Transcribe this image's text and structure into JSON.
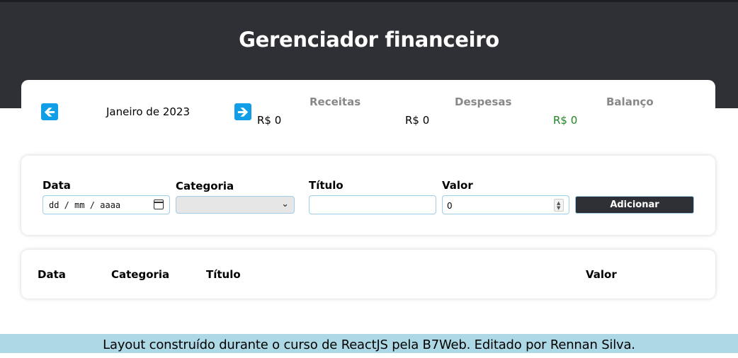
{
  "header": {
    "title": "Gerenciador financeiro"
  },
  "period": {
    "prev_icon": "arrow-left-icon",
    "label": "Janeiro de 2023",
    "next_icon": "arrow-right-icon"
  },
  "summary": {
    "receitas": {
      "title": "Receitas",
      "value": "R$ 0"
    },
    "despesas": {
      "title": "Despesas",
      "value": "R$ 0"
    },
    "balanco": {
      "title": "Balanço",
      "value": "R$ 0",
      "color": "#208520"
    }
  },
  "form": {
    "data": {
      "label": "Data",
      "placeholder": "dd / mm / aaaa"
    },
    "categoria": {
      "label": "Categoria",
      "value": ""
    },
    "titulo": {
      "label": "Título",
      "value": ""
    },
    "valor": {
      "label": "Valor",
      "value": "0"
    },
    "submit_label": "Adicionar"
  },
  "table": {
    "columns": [
      "Data",
      "Categoria",
      "Título",
      "Valor"
    ],
    "rows": []
  },
  "footer": {
    "text": "Layout construído durante o curso de ReactJS pela B7Web. Editado por Rennan Silva."
  },
  "colors": {
    "header_bg": "#2f3035",
    "accent": "#119ee6",
    "footer_bg": "#add8e6",
    "positive": "#208520"
  }
}
